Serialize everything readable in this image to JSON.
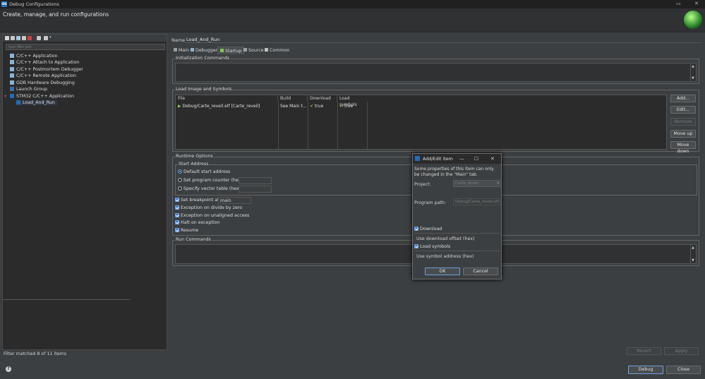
{
  "window": {
    "title": "Debug Configurations",
    "app_icon_text": "IDE",
    "subtitle": "Create, manage, and run configurations"
  },
  "left": {
    "filter_placeholder": "type filter text",
    "items": [
      {
        "label": "C/C++ Application"
      },
      {
        "label": "C/C++ Attach to Application"
      },
      {
        "label": "C/C++ Postmortem Debugger"
      },
      {
        "label": "C/C++ Remote Application"
      },
      {
        "label": "GDB Hardware Debugging"
      },
      {
        "label": "Launch Group"
      },
      {
        "label": "STM32 C/C++ Application"
      },
      {
        "label": "Load_And_Run"
      }
    ],
    "status": "Filter matched 8 of 11 items"
  },
  "config": {
    "name_label": "Name:",
    "name_value": "Load_And_Run",
    "tabs": [
      {
        "label": "Main"
      },
      {
        "label": "Debugger"
      },
      {
        "label": "Startup"
      },
      {
        "label": "Source"
      },
      {
        "label": "Common"
      }
    ],
    "init_commands_label": "Initialization Commands",
    "load_image_label": "Load Image and Symbols",
    "table": {
      "headers": [
        "File",
        "Build",
        "Download",
        "Load symbols"
      ],
      "row": {
        "file": "Debug/Carte_reveil.elf [Carte_reveil]",
        "build": "See Main t...",
        "download": "true",
        "load_symbols": "true"
      }
    },
    "table_buttons": {
      "add": "Add...",
      "edit": "Edit...",
      "remove": "Remove",
      "move_up": "Move up",
      "move_down": "Move down"
    },
    "runtime_label": "Runtime Options",
    "start_address_label": "Start Address",
    "radio_default": "Default start address",
    "radio_pc": "Set program counter (hex):",
    "radio_vector": "Specify vector table (hex):",
    "set_breakpoint": "Set breakpoint at:",
    "breakpoint_value": "main",
    "exception_div": "Exception on divide by zero",
    "exception_unaligned": "Exception on unaligned access",
    "halt_exception": "Halt on exception",
    "resume": "Resume",
    "run_commands_label": "Run Commands",
    "revert": "Revert",
    "apply": "Apply"
  },
  "bottom": {
    "debug": "Debug",
    "close": "Close"
  },
  "dialog": {
    "title": "Add/Edit item",
    "app_icon_text": "IDE",
    "info": "Some properties of this item can only be changed in the \"Main\" tab.",
    "project_label": "Project:",
    "project_value": "Carte_reveil",
    "program_path_label": "Program path:",
    "program_path_value": "Debug/Carte_reveil.elf",
    "download_label": "Download",
    "use_download_offset": "Use download offset (hex)",
    "load_symbols_label": "Load symbols",
    "use_symbol_address": "Use symbol address (hex)",
    "ok": "OK",
    "cancel": "Cancel"
  },
  "icons": {
    "accent": "#3b7ad1",
    "check_color": "#7ec850"
  }
}
